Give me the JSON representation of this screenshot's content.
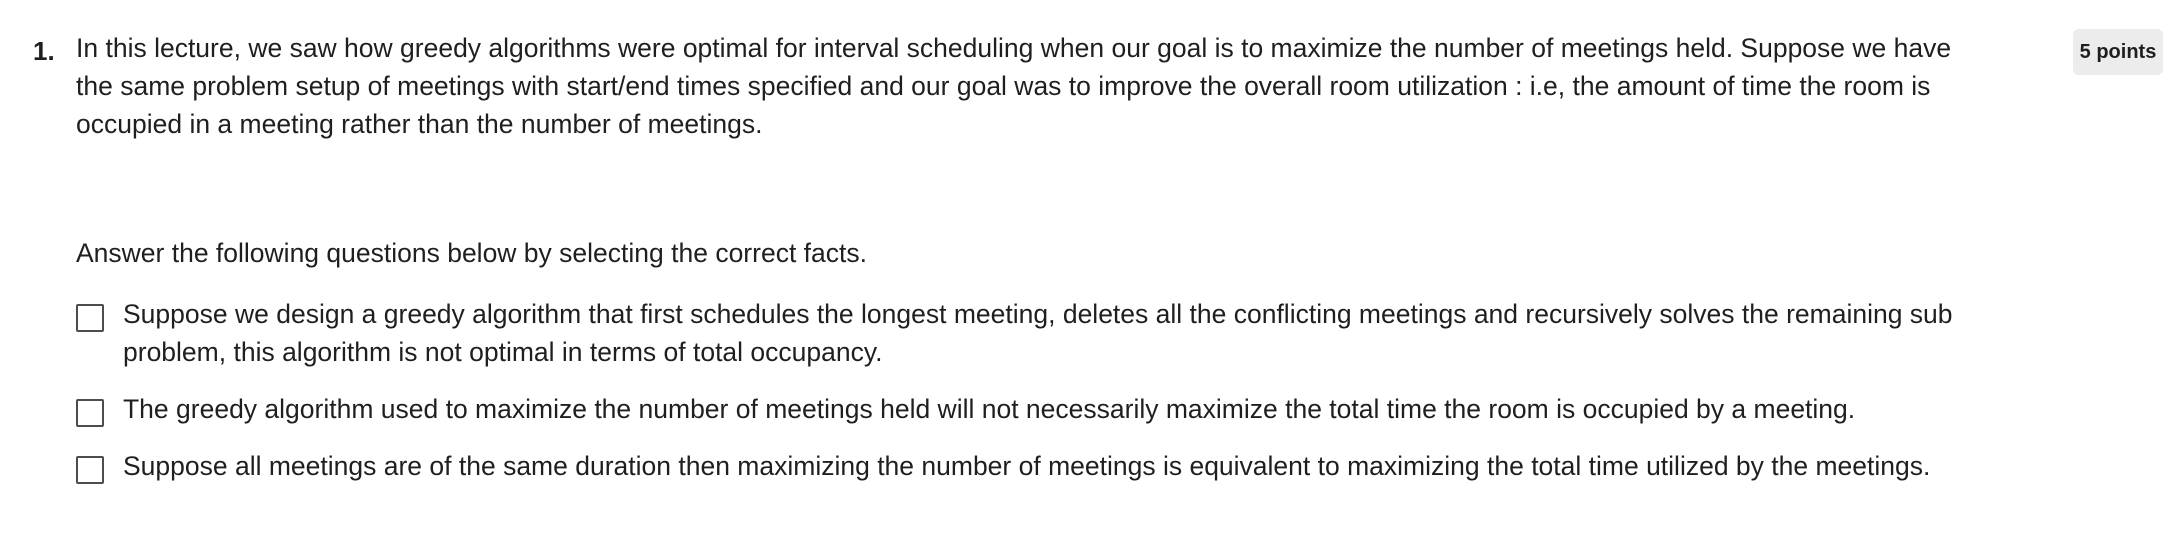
{
  "question": {
    "number": "1.",
    "points": "5 points",
    "prompt": "In this lecture, we saw how greedy algorithms were optimal for interval scheduling when our goal is to maximize the number of meetings held. Suppose we have the same problem setup of meetings with start/end times specified and our goal was to improve the overall room utilization : i.e, the amount of time the room is occupied in a meeting rather than the number of meetings.",
    "instructions": "Answer the following questions below by selecting the correct facts.",
    "options": [
      {
        "label": "Suppose we design a greedy algorithm that first schedules the longest meeting, deletes all the conflicting meetings and recursively solves the remaining sub problem, this algorithm is not optimal in terms of total occupancy.",
        "checked": false
      },
      {
        "label": "The greedy algorithm used to maximize the number of meetings held will not necessarily maximize the total time the room is occupied by a meeting.",
        "checked": false
      },
      {
        "label": "Suppose all meetings are of the same duration then maximizing the number of meetings is equivalent to maximizing the total time utilized by the meetings.",
        "checked": false
      }
    ]
  }
}
